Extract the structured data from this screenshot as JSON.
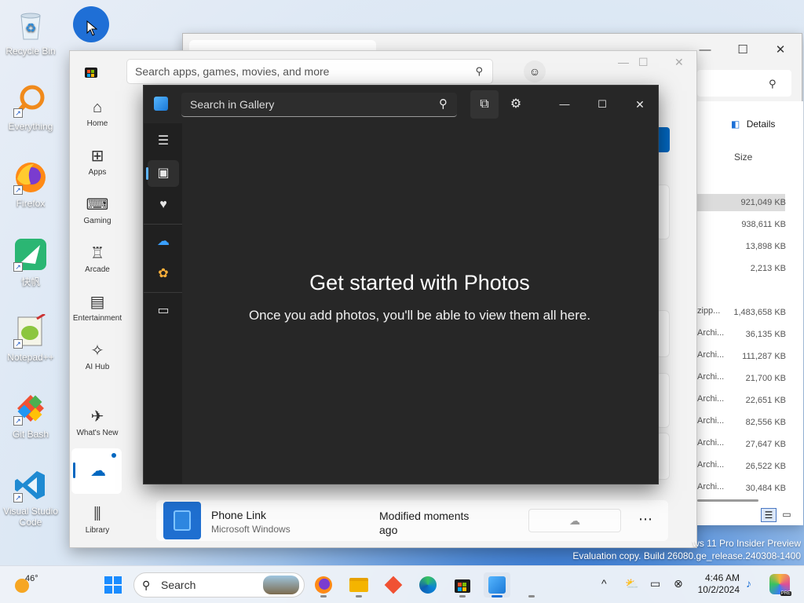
{
  "desktop": {
    "icons": [
      {
        "label": "Recycle Bin",
        "icon": "recycle-bin-icon"
      },
      {
        "label": "Everything",
        "icon": "everything-icon"
      },
      {
        "label": "Firefox",
        "icon": "firefox-icon"
      },
      {
        "label": "快帆",
        "icon": "kuaifan-icon"
      },
      {
        "label": "Notepad++",
        "icon": "notepadpp-icon"
      },
      {
        "label": "Git Bash",
        "icon": "git-bash-icon"
      },
      {
        "label": "Visual Studio Code",
        "icon": "vscode-icon"
      }
    ],
    "watermark_line1": "ws 11 Pro Insider Preview",
    "watermark_line2": "Evaluation copy. Build 26080.ge_release.240308-1400"
  },
  "explorer": {
    "details_label": "Details",
    "column_size": "Size",
    "rows": [
      {
        "type": "",
        "size": "921,049 KB"
      },
      {
        "type": "",
        "size": "938,611 KB"
      },
      {
        "type": "",
        "size": "13,898 KB"
      },
      {
        "type": "",
        "size": "2,213 KB"
      },
      {
        "type": "zipp...",
        "size": "1,483,658 KB"
      },
      {
        "type": "Archi...",
        "size": "36,135 KB"
      },
      {
        "type": "Archi...",
        "size": "111,287 KB"
      },
      {
        "type": "Archi...",
        "size": "21,700 KB"
      },
      {
        "type": "Archi...",
        "size": "22,651 KB"
      },
      {
        "type": "Archi...",
        "size": "82,556 KB"
      },
      {
        "type": "Archi...",
        "size": "27,647 KB"
      },
      {
        "type": "Archi...",
        "size": "26,522 KB"
      },
      {
        "type": "Archi...",
        "size": "30,484 KB"
      }
    ]
  },
  "store": {
    "search_placeholder": "Search apps, games, movies, and more",
    "nav": [
      {
        "label": "Home",
        "icon": "home-icon"
      },
      {
        "label": "Apps",
        "icon": "apps-icon"
      },
      {
        "label": "Gaming",
        "icon": "gamepad-icon"
      },
      {
        "label": "Arcade",
        "icon": "joystick-icon"
      },
      {
        "label": "Entertainment",
        "icon": "clapperboard-icon"
      },
      {
        "label": "AI Hub",
        "icon": "sparkle-icon"
      },
      {
        "label": "What's New",
        "icon": "rocket-icon"
      },
      {
        "label": "",
        "icon": "cloud-download-icon"
      },
      {
        "label": "Library",
        "icon": "library-icon"
      }
    ],
    "download_row": {
      "app_name": "Phone Link",
      "publisher": "Microsoft Windows",
      "status": "Modified moments ago"
    }
  },
  "photos": {
    "search_placeholder": "Search in Gallery",
    "title": "Get started with Photos",
    "subtitle": "Once you add photos, you'll be able to view them all here."
  },
  "taskbar": {
    "weather_temp": "46°",
    "search_label": "Search",
    "time": "4:46 AM",
    "date": "10/2/2024"
  }
}
